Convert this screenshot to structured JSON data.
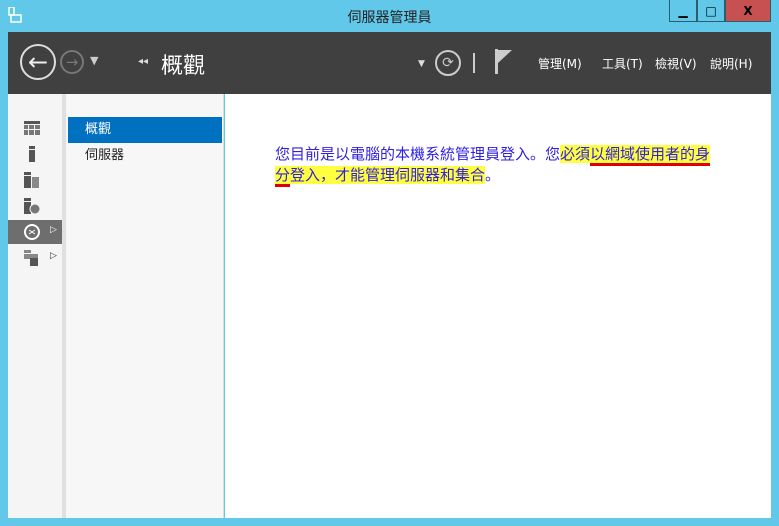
{
  "window": {
    "title": "伺服器管理員",
    "minimize": "▁",
    "maximize": "□",
    "close": "X"
  },
  "header": {
    "breadcrumb_title": "概觀",
    "menus": [
      "管理(M)",
      "工具(T)",
      "檢視(V)",
      "說明(H)"
    ]
  },
  "nav": {
    "items": [
      {
        "label": "概觀",
        "selected": true
      },
      {
        "label": "伺服器",
        "selected": false
      }
    ]
  },
  "content": {
    "seg1": "您目前是以電腦的本機系統管理員登入。您",
    "seg2": "必須",
    "seg3": "以網域使用者",
    "seg4": "的身分",
    "seg5": "登入，才能管理伺服器和集合",
    "seg6": "。"
  },
  "colors": {
    "accent": "#0070c0",
    "titlebar": "#62c8ea",
    "header": "#404040",
    "highlight": "#ffff40",
    "underline": "#e00000"
  }
}
